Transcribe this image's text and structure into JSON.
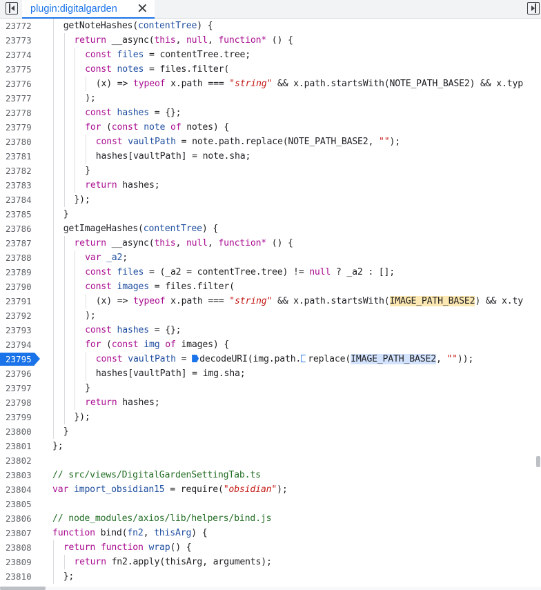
{
  "toolbar": {
    "left_toggle_icon": "panel-left-icon",
    "right_toggle_icon": "panel-right-icon"
  },
  "tab": {
    "label": "plugin:digitalgarden",
    "close_glyph": "✕"
  },
  "editor": {
    "active_line": "23795",
    "lines": [
      {
        "n": "23772",
        "indent": 2,
        "tokens": [
          [
            "plain",
            "getNoteHashes("
          ],
          [
            "var",
            "contentTree"
          ],
          [
            "plain",
            ") {"
          ]
        ]
      },
      {
        "n": "23773",
        "indent": 4,
        "tokens": [
          [
            "kw",
            "return"
          ],
          [
            "plain",
            " __async("
          ],
          [
            "kw",
            "this"
          ],
          [
            "plain",
            ", "
          ],
          [
            "kw",
            "null"
          ],
          [
            "plain",
            ", "
          ],
          [
            "kw",
            "function*"
          ],
          [
            "plain",
            " () {"
          ]
        ]
      },
      {
        "n": "23774",
        "indent": 6,
        "tokens": [
          [
            "kw",
            "const"
          ],
          [
            "plain",
            " "
          ],
          [
            "var",
            "files"
          ],
          [
            "plain",
            " = contentTree.tree;"
          ]
        ]
      },
      {
        "n": "23775",
        "indent": 6,
        "tokens": [
          [
            "kw",
            "const"
          ],
          [
            "plain",
            " "
          ],
          [
            "var",
            "notes"
          ],
          [
            "plain",
            " = files.filter("
          ]
        ]
      },
      {
        "n": "23776",
        "indent": 8,
        "tokens": [
          [
            "plain",
            "(x) => "
          ],
          [
            "kw",
            "typeof"
          ],
          [
            "plain",
            " x.path === "
          ],
          [
            "str",
            "\"string\""
          ],
          [
            "plain",
            " && x.path.startsWith(NOTE_PATH_BASE2) && x.typ"
          ]
        ]
      },
      {
        "n": "23777",
        "indent": 6,
        "tokens": [
          [
            "plain",
            ");"
          ]
        ]
      },
      {
        "n": "23778",
        "indent": 6,
        "tokens": [
          [
            "kw",
            "const"
          ],
          [
            "plain",
            " "
          ],
          [
            "var",
            "hashes"
          ],
          [
            "plain",
            " = {};"
          ]
        ]
      },
      {
        "n": "23779",
        "indent": 6,
        "tokens": [
          [
            "kw",
            "for"
          ],
          [
            "plain",
            " ("
          ],
          [
            "kw",
            "const"
          ],
          [
            "plain",
            " "
          ],
          [
            "var",
            "note"
          ],
          [
            "plain",
            " "
          ],
          [
            "kw",
            "of"
          ],
          [
            "plain",
            " notes) {"
          ]
        ]
      },
      {
        "n": "23780",
        "indent": 8,
        "tokens": [
          [
            "kw",
            "const"
          ],
          [
            "plain",
            " "
          ],
          [
            "var",
            "vaultPath"
          ],
          [
            "plain",
            " = note.path.replace(NOTE_PATH_BASE2, "
          ],
          [
            "str",
            "\"\""
          ],
          [
            "plain",
            ");"
          ]
        ]
      },
      {
        "n": "23781",
        "indent": 8,
        "tokens": [
          [
            "plain",
            "hashes[vaultPath] = note.sha;"
          ]
        ]
      },
      {
        "n": "23782",
        "indent": 6,
        "tokens": [
          [
            "plain",
            "}"
          ]
        ]
      },
      {
        "n": "23783",
        "indent": 6,
        "tokens": [
          [
            "kw",
            "return"
          ],
          [
            "plain",
            " hashes;"
          ]
        ]
      },
      {
        "n": "23784",
        "indent": 4,
        "tokens": [
          [
            "plain",
            "});"
          ]
        ]
      },
      {
        "n": "23785",
        "indent": 2,
        "tokens": [
          [
            "plain",
            "}"
          ]
        ]
      },
      {
        "n": "23786",
        "indent": 2,
        "tokens": [
          [
            "plain",
            "getImageHashes("
          ],
          [
            "var",
            "contentTree"
          ],
          [
            "plain",
            ") {"
          ]
        ]
      },
      {
        "n": "23787",
        "indent": 4,
        "tokens": [
          [
            "kw",
            "return"
          ],
          [
            "plain",
            " __async("
          ],
          [
            "kw",
            "this"
          ],
          [
            "plain",
            ", "
          ],
          [
            "kw",
            "null"
          ],
          [
            "plain",
            ", "
          ],
          [
            "kw",
            "function*"
          ],
          [
            "plain",
            " () {"
          ]
        ]
      },
      {
        "n": "23788",
        "indent": 6,
        "tokens": [
          [
            "kw",
            "var"
          ],
          [
            "plain",
            " "
          ],
          [
            "var",
            "_a2"
          ],
          [
            "plain",
            ";"
          ]
        ]
      },
      {
        "n": "23789",
        "indent": 6,
        "tokens": [
          [
            "kw",
            "const"
          ],
          [
            "plain",
            " "
          ],
          [
            "var",
            "files"
          ],
          [
            "plain",
            " = (_a2 = contentTree.tree) != "
          ],
          [
            "kw",
            "null"
          ],
          [
            "plain",
            " ? _a2 : [];"
          ]
        ]
      },
      {
        "n": "23790",
        "indent": 6,
        "tokens": [
          [
            "kw",
            "const"
          ],
          [
            "plain",
            " "
          ],
          [
            "var",
            "images"
          ],
          [
            "plain",
            " = files.filter("
          ]
        ]
      },
      {
        "n": "23791",
        "indent": 8,
        "tokens": [
          [
            "plain",
            "(x) => "
          ],
          [
            "kw",
            "typeof"
          ],
          [
            "plain",
            " x.path === "
          ],
          [
            "str",
            "\"string\""
          ],
          [
            "plain",
            " && x.path.startsWith("
          ],
          [
            "hl",
            "IMAGE_PATH_BASE2"
          ],
          [
            "plain",
            ") && x.ty"
          ]
        ]
      },
      {
        "n": "23792",
        "indent": 6,
        "tokens": [
          [
            "plain",
            ");"
          ]
        ]
      },
      {
        "n": "23793",
        "indent": 6,
        "tokens": [
          [
            "kw",
            "const"
          ],
          [
            "plain",
            " "
          ],
          [
            "var",
            "hashes"
          ],
          [
            "plain",
            " = {};"
          ]
        ]
      },
      {
        "n": "23794",
        "indent": 6,
        "tokens": [
          [
            "kw",
            "for"
          ],
          [
            "plain",
            " ("
          ],
          [
            "kw",
            "const"
          ],
          [
            "plain",
            " "
          ],
          [
            "var",
            "img"
          ],
          [
            "plain",
            " "
          ],
          [
            "kw",
            "of"
          ],
          [
            "plain",
            " images) {"
          ]
        ]
      },
      {
        "n": "23795",
        "indent": 8,
        "tokens": [
          [
            "kw",
            "const"
          ],
          [
            "plain",
            " "
          ],
          [
            "var",
            "vaultPath"
          ],
          [
            "plain",
            " = "
          ],
          [
            "bp",
            ""
          ],
          [
            "plain",
            "decodeURI(img.path."
          ],
          [
            "bp2",
            ""
          ],
          [
            "plain",
            "replace("
          ],
          [
            "sel",
            "IMAGE_PATH_BASE2"
          ],
          [
            "plain",
            ", "
          ],
          [
            "str",
            "\"\""
          ],
          [
            "plain",
            "));"
          ]
        ]
      },
      {
        "n": "23796",
        "indent": 8,
        "tokens": [
          [
            "plain",
            "hashes[vaultPath] = img.sha;"
          ]
        ]
      },
      {
        "n": "23797",
        "indent": 6,
        "tokens": [
          [
            "plain",
            "}"
          ]
        ]
      },
      {
        "n": "23798",
        "indent": 6,
        "tokens": [
          [
            "kw",
            "return"
          ],
          [
            "plain",
            " hashes;"
          ]
        ]
      },
      {
        "n": "23799",
        "indent": 4,
        "tokens": [
          [
            "plain",
            "});"
          ]
        ]
      },
      {
        "n": "23800",
        "indent": 2,
        "tokens": [
          [
            "plain",
            "}"
          ]
        ]
      },
      {
        "n": "23801",
        "indent": 0,
        "tokens": [
          [
            "plain",
            "};"
          ]
        ]
      },
      {
        "n": "23802",
        "indent": 0,
        "tokens": []
      },
      {
        "n": "23803",
        "indent": 0,
        "tokens": [
          [
            "com",
            "// src/views/DigitalGardenSettingTab.ts"
          ]
        ]
      },
      {
        "n": "23804",
        "indent": 0,
        "tokens": [
          [
            "kw",
            "var"
          ],
          [
            "plain",
            " "
          ],
          [
            "var",
            "import_obsidian15"
          ],
          [
            "plain",
            " = require("
          ],
          [
            "str",
            "\"obsidian\""
          ],
          [
            "plain",
            ");"
          ]
        ]
      },
      {
        "n": "23805",
        "indent": 0,
        "tokens": []
      },
      {
        "n": "23806",
        "indent": 0,
        "tokens": [
          [
            "com",
            "// node_modules/axios/lib/helpers/bind.js"
          ]
        ]
      },
      {
        "n": "23807",
        "indent": 0,
        "tokens": [
          [
            "kw",
            "function"
          ],
          [
            "plain",
            " bind("
          ],
          [
            "var",
            "fn2"
          ],
          [
            "plain",
            ", "
          ],
          [
            "var",
            "thisArg"
          ],
          [
            "plain",
            ") {"
          ]
        ]
      },
      {
        "n": "23808",
        "indent": 2,
        "tokens": [
          [
            "kw",
            "return"
          ],
          [
            "plain",
            " "
          ],
          [
            "kw",
            "function"
          ],
          [
            "plain",
            " "
          ],
          [
            "var",
            "wrap"
          ],
          [
            "plain",
            "() {"
          ]
        ]
      },
      {
        "n": "23809",
        "indent": 4,
        "tokens": [
          [
            "kw",
            "return"
          ],
          [
            "plain",
            " fn2.apply(thisArg, arguments);"
          ]
        ]
      },
      {
        "n": "23810",
        "indent": 2,
        "tokens": [
          [
            "plain",
            "};"
          ]
        ]
      }
    ]
  }
}
